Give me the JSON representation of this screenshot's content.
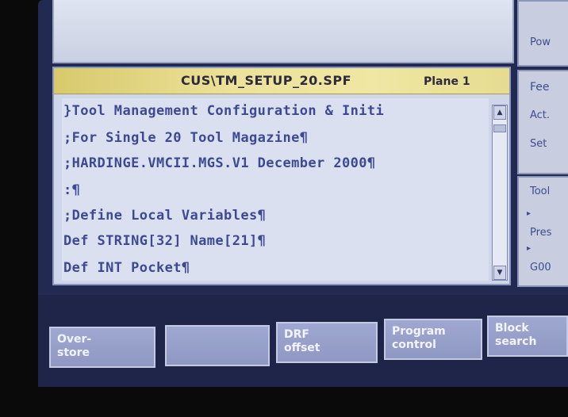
{
  "editor": {
    "file_title": "CUS\\TM_SETUP_20.SPF",
    "plane_label": "Plane 1",
    "lines": [
      "}Tool Management Configuration & Initi",
      ";For Single 20 Tool Magazine¶",
      ";HARDINGE.VMCII.MGS.V1 December 2000¶",
      ":¶",
      ";Define Local Variables¶",
      "Def STRING[32] Name[21]¶",
      "Def INT Pocket¶"
    ]
  },
  "right_panel": {
    "pow_label": "Pow",
    "feed_label": "Fee",
    "act_label": "Act.",
    "set_label": "Set",
    "tool_label": "Tool",
    "pres_label": "Pres",
    "g00_label": "G00"
  },
  "softkeys": [
    {
      "label": "Over-\nstore"
    },
    {
      "label": ""
    },
    {
      "label": "DRF\noffset"
    },
    {
      "label": "Program\ncontrol"
    },
    {
      "label": "Block\nsearch"
    }
  ]
}
